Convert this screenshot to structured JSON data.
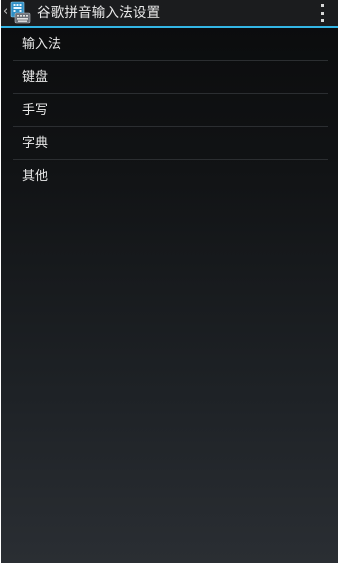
{
  "actionbar": {
    "title": "谷歌拼音输入法设置",
    "up_icon": "chevron-left-icon",
    "app_icon": "keyboard-icon",
    "overflow_icon": "overflow-menu-icon",
    "accent_color": "#33b5e5"
  },
  "settings": {
    "items": [
      {
        "label": "输入法"
      },
      {
        "label": "键盘"
      },
      {
        "label": "手写"
      },
      {
        "label": "字典"
      },
      {
        "label": "其他"
      }
    ]
  }
}
